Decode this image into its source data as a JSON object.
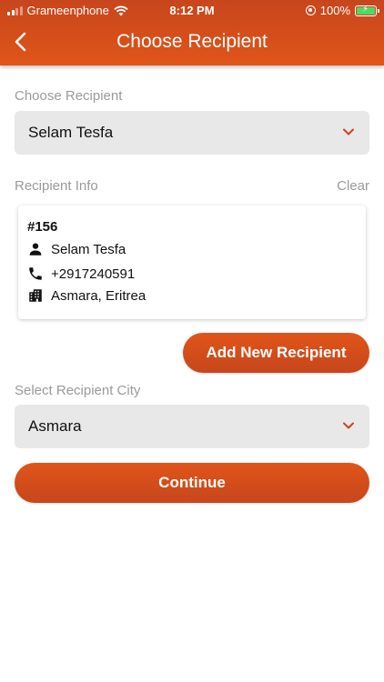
{
  "status": {
    "carrier": "Grameenphone",
    "time": "8:12 PM",
    "battery": "100%"
  },
  "header": {
    "title": "Choose Recipient"
  },
  "recipient": {
    "label": "Choose Recipient",
    "selected": "Selam Tesfa"
  },
  "info": {
    "label": "Recipient Info",
    "clear_label": "Clear",
    "id": "#156",
    "name": "Selam Tesfa",
    "phone": "+2917240591",
    "location": "Asmara, Eritrea"
  },
  "actions": {
    "add_new": "Add New Recipient",
    "continue": "Continue"
  },
  "city": {
    "label": "Select Recipient City",
    "selected": "Asmara"
  },
  "colors": {
    "accent": "#e0551a",
    "accent_dark": "#c7461c",
    "field_bg": "#e8e8e8",
    "label_gray": "#9a9a9a"
  }
}
